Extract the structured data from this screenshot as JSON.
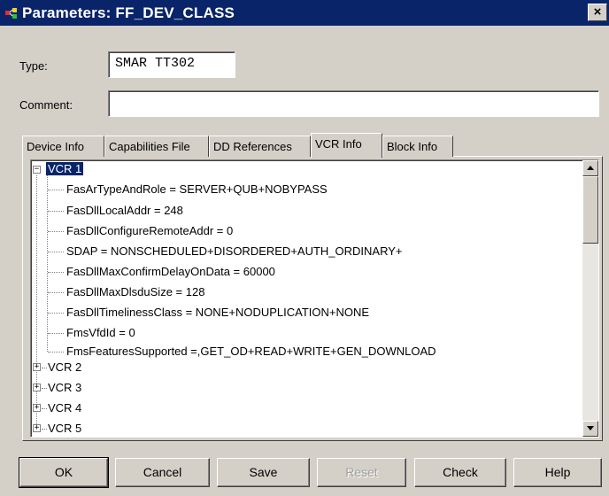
{
  "window": {
    "title": "Parameters: FF_DEV_CLASS",
    "close_label": "×"
  },
  "form": {
    "type_label": "Type:",
    "type_value": "SMAR TT302",
    "comment_label": "Comment:",
    "comment_value": ""
  },
  "tabs": [
    {
      "label": "Device Info",
      "active": false
    },
    {
      "label": "Capabilities File",
      "active": false
    },
    {
      "label": "DD References",
      "active": false
    },
    {
      "label": "VCR Info",
      "active": true
    },
    {
      "label": "Block Info",
      "active": false
    }
  ],
  "tree": {
    "root": {
      "label": "VCR 1",
      "expanded": true,
      "expander": "−"
    },
    "children": [
      "FasArTypeAndRole = SERVER+QUB+NOBYPASS",
      "FasDllLocalAddr = 248",
      "FasDllConfigureRemoteAddr = 0",
      "SDAP = NONSCHEDULED+DISORDERED+AUTH_ORDINARY+",
      "FasDllMaxConfirmDelayOnData = 60000",
      "FasDllMaxDlsduSize = 128",
      "FasDllTimelinessClass = NONE+NODUPLICATION+NONE",
      "FmsVfdId = 0",
      "FmsFeaturesSupported =,GET_OD+READ+WRITE+GEN_DOWNLOAD"
    ],
    "siblings": [
      {
        "label": "VCR 2",
        "expander": "+"
      },
      {
        "label": "VCR 3",
        "expander": "+"
      },
      {
        "label": "VCR 4",
        "expander": "+"
      },
      {
        "label": "VCR 5",
        "expander": "+"
      }
    ]
  },
  "buttons": {
    "ok": "OK",
    "cancel": "Cancel",
    "save": "Save",
    "reset": "Reset",
    "check": "Check",
    "help": "Help"
  },
  "colors": {
    "title_bar": "#0a246a",
    "selection": "#0a246a",
    "face": "#d4d0c8"
  },
  "icons": {
    "app": "parameters-app-icon",
    "close": "close-icon",
    "scroll_up": "arrow-up-icon",
    "scroll_down": "arrow-down-icon"
  }
}
